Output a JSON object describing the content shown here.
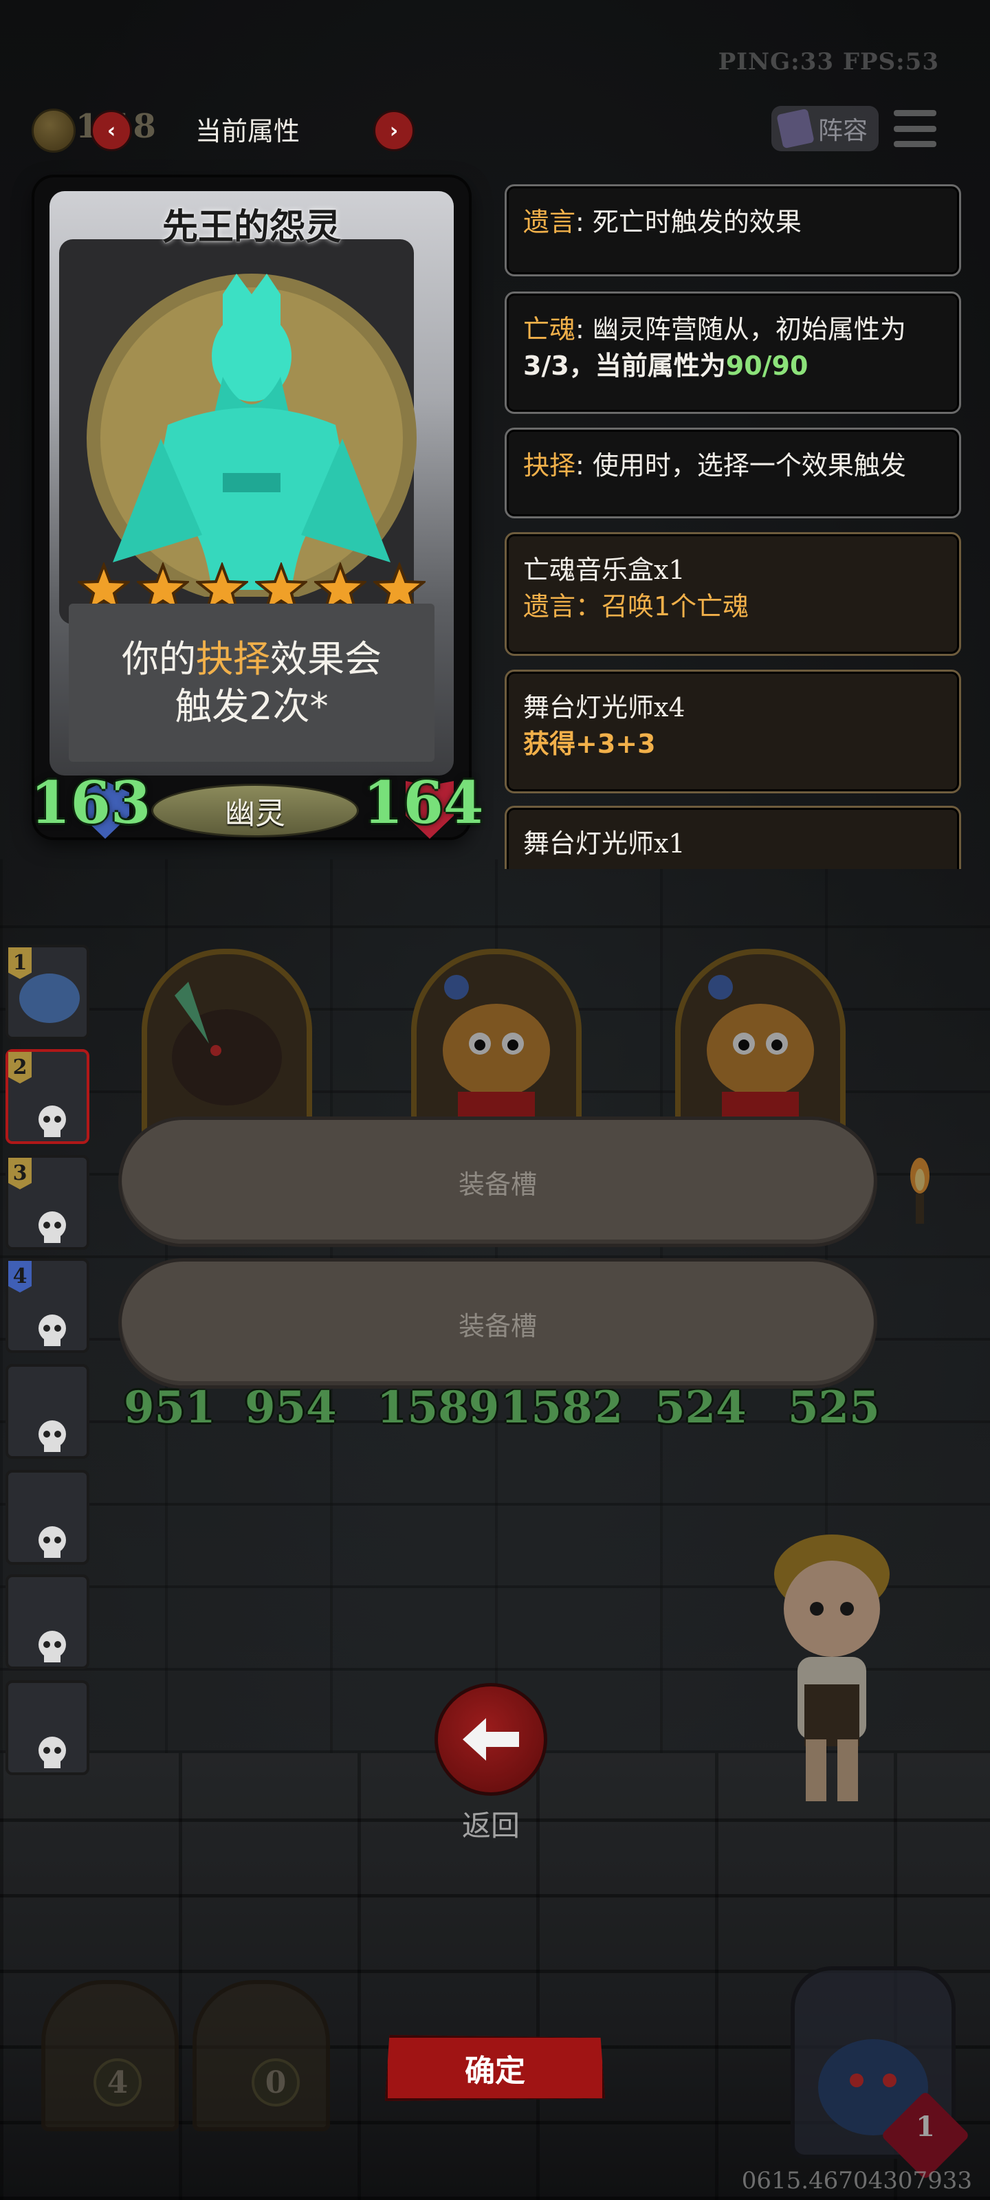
{
  "hud": {
    "debug": "PING:33   FPS:53",
    "gold": "1  18",
    "prev_label": "‹",
    "title": "当前属性",
    "next_label": "›",
    "lineup_label": "阵容"
  },
  "card": {
    "name": "先王的怨灵",
    "stars": 6,
    "desc_line1_pre": "你的",
    "desc_line1_kw": "抉择",
    "desc_line1_post": "效果会",
    "desc_line2": "触发2次*",
    "attack": "163",
    "health": "164",
    "tribe": "幽灵"
  },
  "effects": [
    {
      "kw": "遗言",
      "text": ": 死亡时触发的效果"
    },
    {
      "kw": "亡魂",
      "text": ": 幽灵阵营随从，初始属性为",
      "line2_pre": "3/3，当前属性为",
      "line2_num": "90/90"
    },
    {
      "kw": "抉择",
      "text": ": 使用时，选择一个效果触发"
    },
    {
      "title": "亡魂音乐盒x1",
      "sub": "遗言：召唤1个亡魂"
    },
    {
      "title": "舞台灯光师x4",
      "sub": "获得+3+3"
    },
    {
      "title": "舞台灯光师x1"
    }
  ],
  "side_team": [
    "1",
    "2",
    "3",
    "4"
  ],
  "board_stats": [
    {
      "atk": "951",
      "hp": "954"
    },
    {
      "atk": "1589",
      "hp": "1582"
    },
    {
      "atk": "524",
      "hp": "525"
    }
  ],
  "slots": [
    "装备槽",
    "装备槽"
  ],
  "back_label": "返回",
  "confirm_label": "确定",
  "chests": [
    "4",
    "0"
  ],
  "hero_health": "1",
  "seed": "0615.46704307933"
}
